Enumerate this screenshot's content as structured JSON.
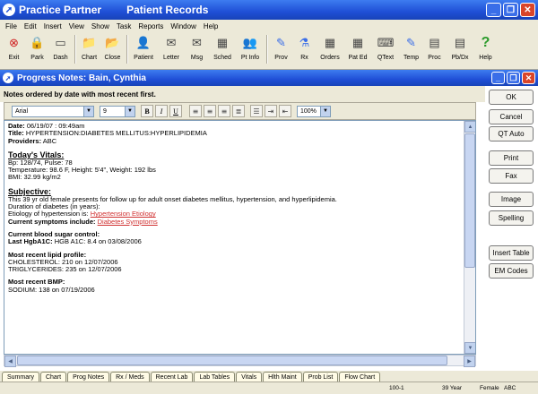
{
  "window": {
    "app_title": "Practice Partner",
    "subtitle": "Patient Records"
  },
  "menu": [
    "File",
    "Edit",
    "Insert",
    "View",
    "Show",
    "Task",
    "Reports",
    "Window",
    "Help"
  ],
  "toolbar": [
    {
      "label": "Exit",
      "icon": "exit-icon",
      "glyph": "⊗"
    },
    {
      "label": "Park",
      "icon": "lock-icon",
      "glyph": "🔒"
    },
    {
      "label": "Dash",
      "icon": "dash-icon",
      "glyph": "▭"
    },
    {
      "label": "Chart",
      "icon": "chart-icon",
      "glyph": "📁"
    },
    {
      "label": "Close",
      "icon": "close-chart-icon",
      "glyph": "📂"
    },
    {
      "label": "Patient",
      "icon": "patient-icon",
      "glyph": "👤"
    },
    {
      "label": "Letter",
      "icon": "letter-icon",
      "glyph": "✉"
    },
    {
      "label": "Msg",
      "icon": "message-icon",
      "glyph": "✉"
    },
    {
      "label": "Sched",
      "icon": "schedule-icon",
      "glyph": "▦"
    },
    {
      "label": "Pt Info",
      "icon": "patient-info-icon",
      "glyph": "👥"
    },
    {
      "label": "Prov",
      "icon": "provider-icon",
      "glyph": "✎"
    },
    {
      "label": "Rx",
      "icon": "rx-icon",
      "glyph": "⚗"
    },
    {
      "label": "Orders",
      "icon": "orders-icon",
      "glyph": "▦"
    },
    {
      "label": "Pat Ed",
      "icon": "patient-education-icon",
      "glyph": "▦"
    },
    {
      "label": "QText",
      "icon": "qtext-icon",
      "glyph": "⌨"
    },
    {
      "label": "Temp",
      "icon": "template-icon",
      "glyph": "✎"
    },
    {
      "label": "Proc",
      "icon": "procedure-icon",
      "glyph": "▤"
    },
    {
      "label": "Pb/Dx",
      "icon": "problem-dx-icon",
      "glyph": "▤"
    },
    {
      "label": "Help",
      "icon": "help-icon",
      "glyph": "?"
    }
  ],
  "progress_notes": {
    "title": "Progress Notes: Bain, Cynthia",
    "header": "Notes ordered by date with most recent first."
  },
  "format_bar": {
    "font": "Arial",
    "size": "9",
    "zoom": "100%"
  },
  "note": {
    "date_label": "Date:",
    "date_value": "06/19/07 : 09:49am",
    "title_label": "Title:",
    "title_value": "HYPERTENSION:DIABETES MELLITUS:HYPERLIPIDEMIA",
    "providers_label": "Providers:",
    "providers_value": "ABC",
    "vitals_heading": "Today's Vitals:",
    "vitals_lines": [
      "Bp: 128/74, Pulse: 78",
      "Temperature: 98.6 F, Height: 5'4\", Weight: 192 lbs",
      "BMI: 32.99 kg/m2"
    ],
    "subjective_heading": "Subjective:",
    "subjective_line": "This 39 yr old female presents for follow up for adult onset diabetes mellitus, hypertension, and hyperlipidemia.",
    "duration_line": "Duration of diabetes (in years):",
    "etiology_label": "Etiology of hypertension is:",
    "etiology_link": "Hypertension Etiology",
    "symptoms_label": "Current symptoms include:",
    "symptoms_link": "Diabetes Symptoms",
    "blood_sugar_heading": "Current blood sugar control:",
    "hgba1c_label": "Last HgbA1C:",
    "hgba1c_value": "HGB A1C: 8.4 on 03/08/2006",
    "lipid_heading": "Most recent lipid profile:",
    "lipid_lines": [
      "CHOLESTEROL: 210 on 12/07/2006",
      "TRIGLYCERIDES: 235 on 12/07/2006"
    ],
    "bmp_heading": "Most recent BMP:",
    "bmp_lines": [
      "SODIUM: 138 on 07/19/2006"
    ]
  },
  "side_buttons": [
    "OK",
    "Cancel",
    "QT Auto",
    "Print",
    "Fax",
    "Image",
    "Spelling",
    "Insert Table",
    "EM Codes"
  ],
  "tabs": [
    "Summary",
    "Chart",
    "Prog Notes",
    "Rx / Meds",
    "Recent Lab",
    "Lab Tables",
    "Vitals",
    "Hlth Maint",
    "Prob List",
    "Flow Chart"
  ],
  "status": {
    "id": "100-1",
    "age": "39 Year",
    "sex": "Female",
    "provider": "ABC"
  }
}
